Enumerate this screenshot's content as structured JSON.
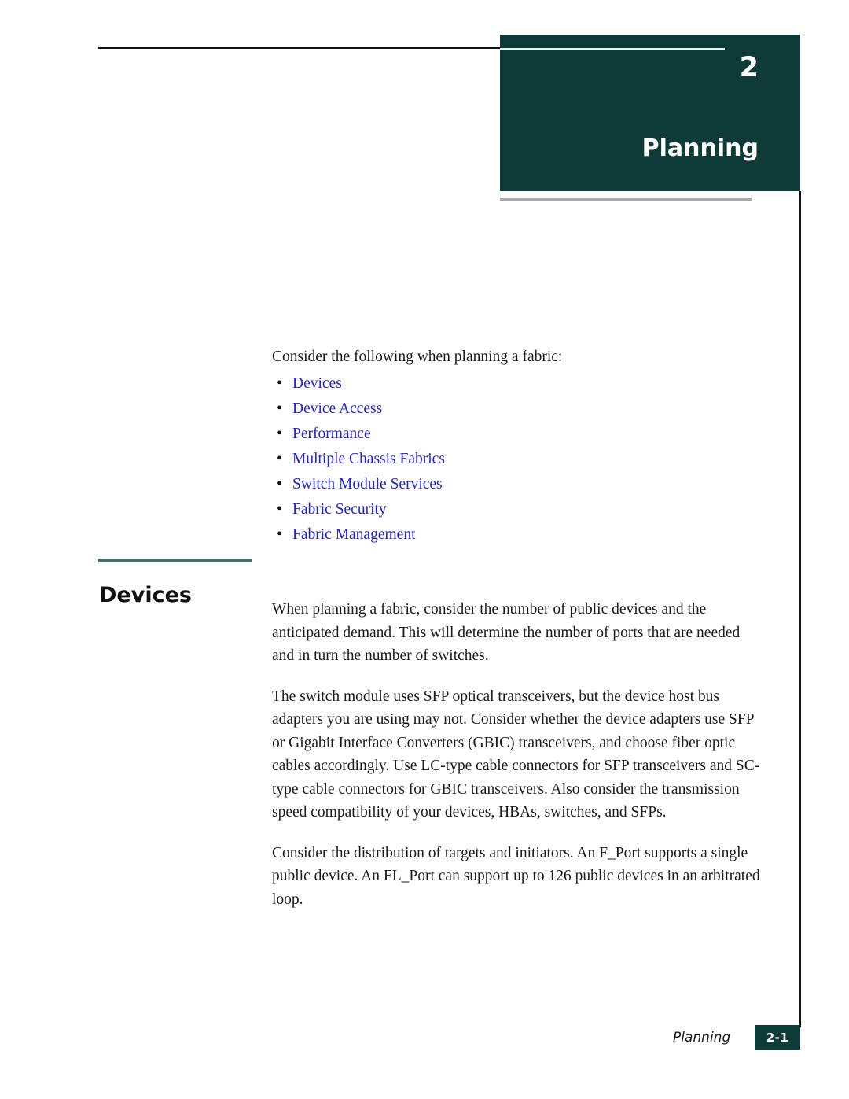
{
  "chapter": {
    "number": "2",
    "title": "Planning"
  },
  "intro": {
    "line": "Consider the following when planning a fabric:"
  },
  "planning_links": [
    {
      "label": "Devices",
      "bullet": "•"
    },
    {
      "label": "Device Access",
      "bullet": "•"
    },
    {
      "label": "Performance",
      "bullet": "•"
    },
    {
      "label": "Multiple Chassis Fabrics",
      "bullet": "•"
    },
    {
      "label": "Switch Module Services",
      "bullet": "•"
    },
    {
      "label": "Fabric Security",
      "bullet": "•"
    },
    {
      "label": "Fabric Management",
      "bullet": "•"
    }
  ],
  "section": {
    "heading": "Devices",
    "paragraphs": [
      "When planning a fabric, consider the number of public devices and the anticipated demand. This will determine the number of ports that are needed and in turn the number of switches.",
      "The switch module uses SFP optical transceivers, but the device host bus adapters you are using may not. Consider whether the device adapters use SFP or Gigabit Interface Converters (GBIC) transceivers, and choose fiber optic cables accordingly. Use LC-type cable connectors for SFP transceivers and SC-type cable connectors for GBIC transceivers. Also consider the transmission speed compatibility of your devices, HBAs, switches, and SFPs.",
      "Consider the distribution of targets and initiators. An F_Port supports a single public device. An FL_Port can support up to 126 public devices in an arbitrated loop."
    ]
  },
  "footer": {
    "label": "Planning",
    "page": "2-1"
  },
  "colors": {
    "banner_teal": "#0e3a38",
    "link_blue": "#2222dd",
    "heading_rule": "#4a6a68",
    "below_banner_rule": "#a8a8a8",
    "rule_black": "#121212"
  }
}
